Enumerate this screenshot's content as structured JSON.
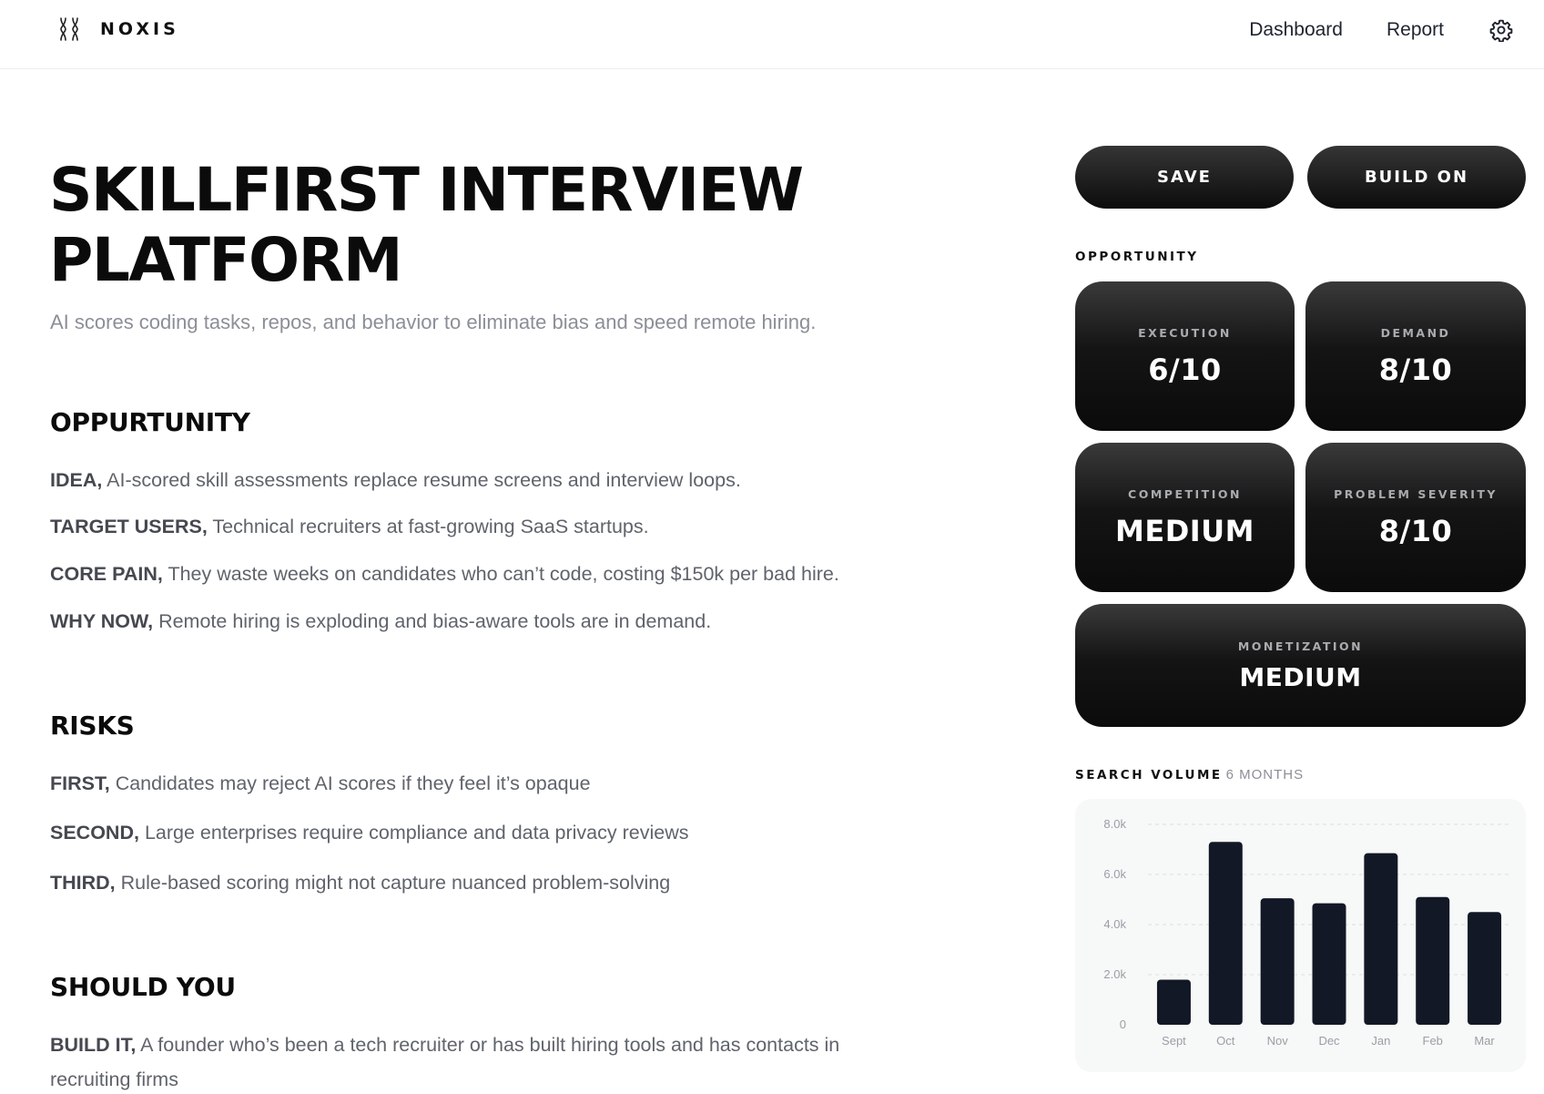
{
  "header": {
    "brand": "NOXIS",
    "nav": {
      "dashboard": "Dashboard",
      "report": "Report"
    }
  },
  "page": {
    "title": "SKILLFIRST INTERVIEW PLATFORM",
    "subtitle": "AI scores coding tasks, repos, and behavior to eliminate bias and speed remote hiring."
  },
  "opportunity_section": {
    "heading": "OPPURTUNITY",
    "items": [
      {
        "label": "IDEA,",
        "text": "AI-scored skill assessments replace resume screens and interview loops."
      },
      {
        "label": "TARGET USERS,",
        "text": "Technical recruiters at fast-growing SaaS startups."
      },
      {
        "label": "CORE PAIN,",
        "text": "They waste weeks on candidates who can’t code, costing $150k per bad hire."
      },
      {
        "label": "WHY NOW,",
        "text": "Remote hiring is exploding and bias-aware tools are in demand."
      }
    ]
  },
  "risks_section": {
    "heading": "RISKS",
    "items": [
      {
        "label": "FIRST,",
        "text": "Candidates may reject AI scores if they feel it’s opaque"
      },
      {
        "label": "SECOND,",
        "text": "Large enterprises require compliance and data privacy reviews"
      },
      {
        "label": "THIRD,",
        "text": "Rule-based scoring might not capture nuanced problem-solving"
      }
    ]
  },
  "should_you_section": {
    "heading": "SHOULD YOU",
    "items": [
      {
        "label": "BUILD IT,",
        "text": "A founder who’s been a tech recruiter or has built hiring tools and has contacts in recruiting firms"
      }
    ]
  },
  "actions": {
    "save": "SAVE",
    "build_on": "BUILD ON"
  },
  "opportunity_panel": {
    "heading": "OPPORTUNITY",
    "cards": {
      "execution": {
        "label": "EXECUTION",
        "value": "6/10"
      },
      "demand": {
        "label": "DEMAND",
        "value": "8/10"
      },
      "competition": {
        "label": "COMPETITION",
        "value": "MEDIUM"
      },
      "problem_severity": {
        "label": "PROBLEM SEVERITY",
        "value": "8/10"
      },
      "monetization": {
        "label": "MONETIZATION",
        "value": "MEDIUM"
      }
    }
  },
  "search_volume": {
    "heading": "SEARCH VOLUME",
    "period": "6 MONTHS"
  },
  "colors": {
    "bar": "#121826",
    "card_dark": "#0b0b0b",
    "muted_text": "#8b8f97"
  },
  "chart_data": {
    "type": "bar",
    "categories": [
      "Sept",
      "Oct",
      "Nov",
      "Dec",
      "Jan",
      "Feb",
      "Mar"
    ],
    "values": [
      1800,
      7300,
      5050,
      4850,
      6850,
      5100,
      4500
    ],
    "y_ticks": [
      0,
      2000,
      4000,
      6000,
      8000
    ],
    "y_tick_labels": [
      "0",
      "2.0k",
      "4.0k",
      "6.0k",
      "8.0k"
    ],
    "ylim": [
      0,
      8000
    ],
    "grid": "horizontal dashed",
    "title": "",
    "xlabel": "",
    "ylabel": ""
  }
}
